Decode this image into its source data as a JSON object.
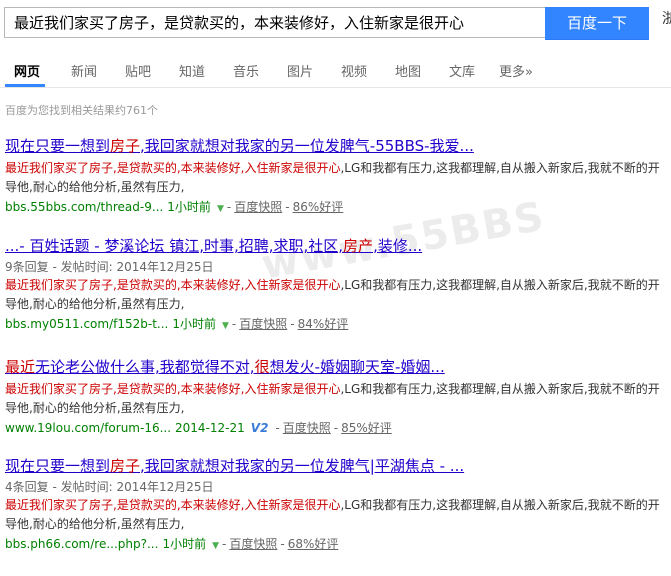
{
  "search": {
    "query": "最近我们家买了房子，是贷款买的，本来装修好，入住新家是很开心",
    "button_label": "百度一下",
    "cut_link": "浙"
  },
  "nav": {
    "items": [
      "网页",
      "新闻",
      "贴吧",
      "知道",
      "音乐",
      "图片",
      "视频",
      "地图",
      "文库",
      "更多»"
    ],
    "active_index": 0
  },
  "result_count": "百度为您找到相关结果约761个",
  "results": [
    {
      "title_parts": [
        "现在只要一想到",
        "房子",
        ",我回家就想对我家的另一位发脾气-55BBS-我爱..."
      ],
      "meta": "",
      "abs_red": "最近我们家买了房子,是贷款买的,本来装修好,入住新家是很开心",
      "abs_rest": ",LG和我都有压力,这我都理解,自从搬入新家后,我就不断的开导他,耐心的给他分析,虽然有压力,",
      "url": "bbs.55bbs.com/thread-9...",
      "time": "1小时前",
      "badge": "",
      "snapshot": "百度快照",
      "rating": "86%好评"
    },
    {
      "title_parts": [
        "...- 百姓话题 - 梦溪论坛 镇江,时事,招聘,求职,社区,",
        "房产",
        ",装修..."
      ],
      "meta": "9条回复 - 发帖时间: 2014年12月25日",
      "abs_red": "最近我们家买了房子,是贷款买的,本来装修好,入住新家是很开心",
      "abs_rest": ",LG和我都有压力,这我都理解,自从搬入新家后,我就不断的开导他,耐心的给他分析,虽然有压力,",
      "url": "bbs.my0511.com/f152b-t...",
      "time": "1小时前",
      "badge": "",
      "snapshot": "百度快照",
      "rating": "84%好评"
    },
    {
      "title_parts": [
        "最近",
        "无论老公做什么事,我都觉得不对,",
        "很",
        "想发火-婚姻聊天室-婚姻..."
      ],
      "meta": "",
      "abs_red": "最近我们家买了房子,是贷款买的,本来装修好,入住新家是很开心",
      "abs_rest": ",LG和我都有压力,这我都理解,自从搬入新家后,我就不断的开导他,耐心的给他分析,虽然有压力,",
      "url": "www.19lou.com/forum-16...",
      "time": "2014-12-21",
      "badge": "V2",
      "snapshot": "百度快照",
      "rating": "85%好评"
    },
    {
      "title_parts": [
        "现在只要一想到",
        "房子",
        ",我回家就想对我家的另一位发脾气|平湖焦点 - ..."
      ],
      "meta": "4条回复 - 发帖时间: 2014年12月25日",
      "abs_red": "最近我们家买了房子,是贷款买的,本来装修好,入住新家是很开心",
      "abs_rest": ",LG和我都有压力,这我都理解,自从搬入新家后,我就不断的开导他,耐心的给他分析,虽然有压力,",
      "url": "bbs.ph66.com/re...php?...",
      "time": "1小时前",
      "badge": "",
      "snapshot": "百度快照",
      "rating": "68%好评"
    }
  ],
  "watermark": "www.55BBS"
}
